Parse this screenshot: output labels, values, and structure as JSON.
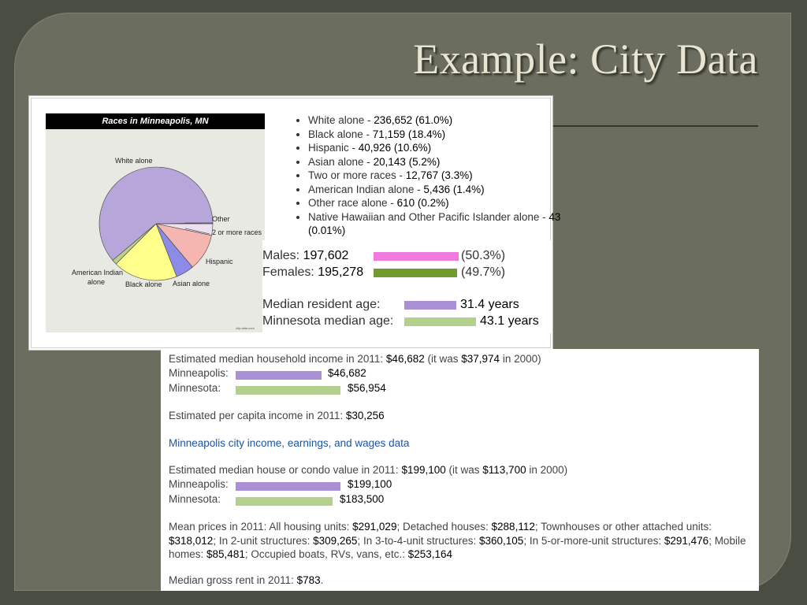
{
  "slide": {
    "title": "Example: City Data"
  },
  "races": {
    "chart_title": "Races in Minneapolis, MN",
    "chart_labels": {
      "white": "White alone",
      "other": "Other",
      "two_or_more": "2 or more races",
      "hispanic": "Hispanic",
      "asian": "Asian alone",
      "black": "Black alone",
      "american_indian_1": "American Indian",
      "american_indian_2": "alone"
    },
    "watermark": "city-data.com",
    "items": [
      {
        "label": "White alone - ",
        "value": "236,652 (61.0%)"
      },
      {
        "label": "Black alone - ",
        "value": "71,159 (18.4%)"
      },
      {
        "label": "Hispanic - ",
        "value": "40,926 (10.6%)"
      },
      {
        "label": "Asian alone - ",
        "value": "20,143 (5.2%)"
      },
      {
        "label": "Two or more races - ",
        "value": "12,767 (3.3%)"
      },
      {
        "label": "American Indian alone - ",
        "value": "5,436 (1.4%)"
      },
      {
        "label": "Other race alone - ",
        "value": "610 (0.2%)"
      },
      {
        "label": "Native Hawaiian and Other Pacific Islander alone - ",
        "value": "43 (0.01%)"
      }
    ]
  },
  "chart_data": {
    "type": "pie",
    "title": "Races in Minneapolis, MN",
    "categories": [
      "White alone",
      "Black alone",
      "Hispanic",
      "Asian alone",
      "2 or more races",
      "American Indian alone",
      "Other"
    ],
    "values": [
      61.0,
      18.4,
      10.6,
      5.2,
      3.3,
      1.4,
      0.2
    ],
    "colors": [
      "#b7a6da",
      "#ffff8c",
      "#f5b5b0",
      "#8c8ce8",
      "#ece0f0",
      "#b9cf8a",
      "#7fb07f"
    ]
  },
  "demographics": {
    "males_label": "Males: ",
    "males_value": "197,602",
    "males_pct": "(50.3%)",
    "males_share": 50.3,
    "females_label": "Females: ",
    "females_value": "195,278",
    "females_pct": "(49.7%)",
    "females_share": 49.7,
    "male_color": "#f07ae0",
    "female_color": "#6e9a2e",
    "median_age_label": "Median resident age: ",
    "median_age_value": "31.4 years",
    "mn_age_label": "Minnesota median age: ",
    "mn_age_value": "43.1 years",
    "city_color": "#a98fd6",
    "state_color": "#b3d08c"
  },
  "income": {
    "household_label": "Estimated median household income in 2011: ",
    "household_value": "$46,682",
    "household_mid": " (it was ",
    "household_2000": "$37,974",
    "household_end": " in 2000)",
    "city_label": "Minneapolis:",
    "state_label": "Minnesota:",
    "city_household": "$46,682",
    "state_household": "$56,954",
    "per_capita_label": "Estimated per capita income in 2011: ",
    "per_capita_value": "$30,256",
    "link_text": "Minneapolis city income, earnings, and wages data",
    "house_label": "Estimated median house or condo value in 2011: ",
    "house_value": "$199,100",
    "house_mid": " (it was ",
    "house_2000": "$113,700",
    "house_end": " in 2000)",
    "city_house": "$199,100",
    "state_house": "$183,500",
    "mean_prices": [
      {
        "t": "Mean prices in 2011: All housing units: ",
        "v": "$291,029"
      },
      {
        "t": "; Detached houses: ",
        "v": "$288,112"
      },
      {
        "t": "; Townhouses or other attached units: ",
        "v": "$318,012"
      },
      {
        "t": "; In 2-unit structures: ",
        "v": "$309,265"
      },
      {
        "t": "; In 3-to-4-unit structures: ",
        "v": "$360,105"
      },
      {
        "t": "; In 5-or-more-unit structures: ",
        "v": "$291,476"
      },
      {
        "t": "; Mobile homes: ",
        "v": "$85,481"
      },
      {
        "t": "; Occupied boats, RVs, vans, etc.: ",
        "v": "$253,164"
      }
    ],
    "rent_label": "Median gross rent in 2011: ",
    "rent_value": "$783",
    "rent_end": "."
  }
}
